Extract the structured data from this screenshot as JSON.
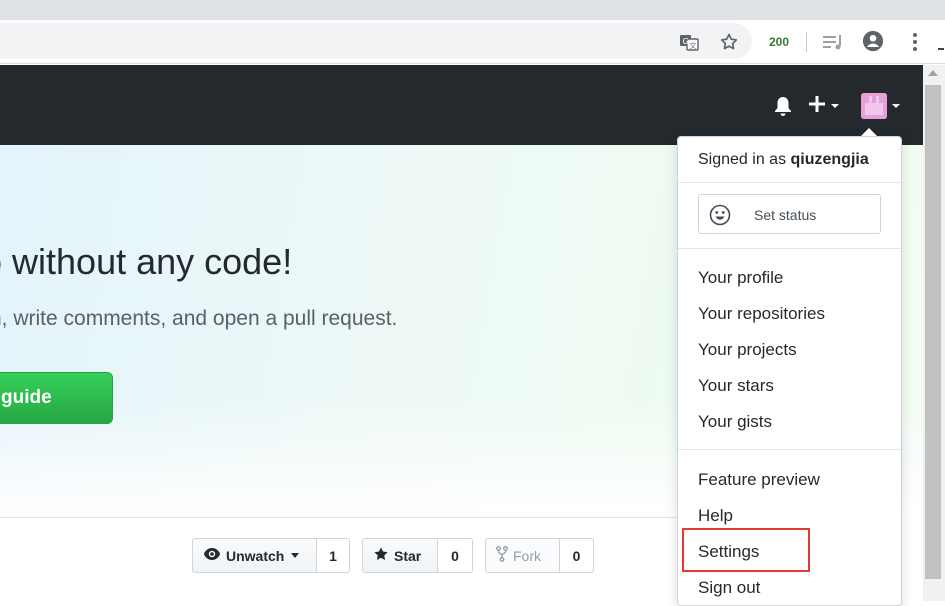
{
  "browser": {
    "extension_badge": "200"
  },
  "hero": {
    "title": "o without any code!",
    "subtitle": "h, write comments, and open a pull request.",
    "button_label": "guide"
  },
  "repo_actions": {
    "watch_label": "Unwatch",
    "watch_count": "1",
    "star_label": "Star",
    "star_count": "0",
    "fork_label": "Fork",
    "fork_count": "0"
  },
  "user_menu": {
    "signed_in_prefix": "Signed in as",
    "username": "qiuzengjia",
    "set_status": "Set status",
    "items": [
      "Your profile",
      "Your repositories",
      "Your projects",
      "Your stars",
      "Your gists"
    ],
    "items2": [
      "Feature preview",
      "Help",
      "Settings",
      "Sign out"
    ]
  },
  "colors": {
    "header_bg": "#24292e",
    "avatar": "#e8a0d8",
    "primary_button": "#28a745",
    "highlight": "#e53935"
  }
}
